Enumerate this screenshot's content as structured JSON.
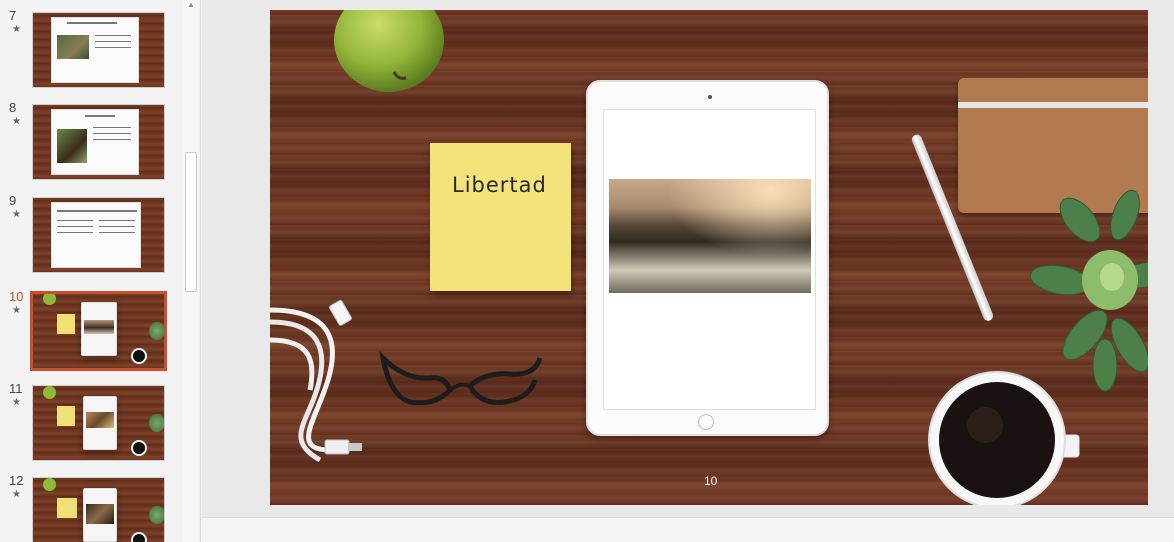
{
  "thumbnails": [
    {
      "number": "7",
      "star": "★",
      "active": false
    },
    {
      "number": "8",
      "star": "★",
      "active": false
    },
    {
      "number": "9",
      "star": "★",
      "active": false
    },
    {
      "number": "10",
      "star": "★",
      "active": true
    },
    {
      "number": "11",
      "star": "★",
      "active": false
    },
    {
      "number": "12",
      "star": "★",
      "active": false
    }
  ],
  "slide": {
    "sticky_text": "Libertad",
    "page_number": "10"
  },
  "colors": {
    "active_accent": "#c8502c",
    "wood": "#6b3422",
    "sticky": "#f4e37a"
  }
}
